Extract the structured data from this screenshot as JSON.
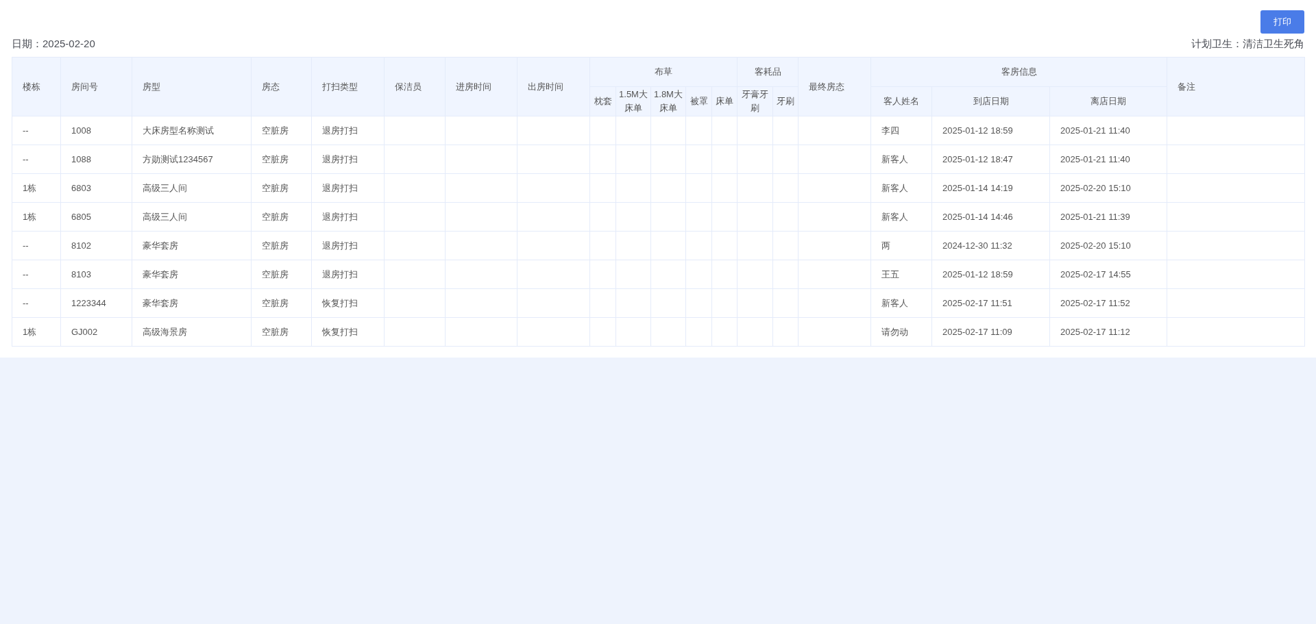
{
  "print_button": "打印",
  "date": "日期：2025-02-20",
  "plan": "计划卫生：清洁卫生死角",
  "table": {
    "columns": [
      {
        "label": "楼栋"
      },
      {
        "label": "房间号"
      },
      {
        "label": "房型"
      },
      {
        "label": "房态"
      },
      {
        "label": "打扫类型"
      },
      {
        "label": "保洁员"
      },
      {
        "label": "进房时间"
      },
      {
        "label": "出房时间"
      },
      {
        "label": "布草",
        "children": [
          {
            "label": "枕套"
          },
          {
            "label": "1.5M大床单"
          },
          {
            "label": "1.8M大床单"
          },
          {
            "label": "被罩"
          },
          {
            "label": "床单"
          }
        ]
      },
      {
        "label": "客耗品",
        "children": [
          {
            "label": "牙膏牙刷"
          },
          {
            "label": "牙刷"
          }
        ]
      },
      {
        "label": "最终房态"
      },
      {
        "label": "客房信息",
        "children": [
          {
            "label": "客人姓名"
          },
          {
            "label": "到店日期"
          },
          {
            "label": "离店日期"
          }
        ]
      },
      {
        "label": "备注"
      }
    ],
    "rows": [
      {
        "building": "--",
        "room_no": "1008",
        "room_type": "大床房型名称测试",
        "room_status": "空脏房",
        "clean_type": "退房打扫",
        "guest": "李四",
        "arrival": "2025-01-12 18:59",
        "departure": "2025-01-21 11:40"
      },
      {
        "building": "--",
        "room_no": "1088",
        "room_type": "方勋测试1234567",
        "room_status": "空脏房",
        "clean_type": "退房打扫",
        "guest": "新客人",
        "arrival": "2025-01-12 18:47",
        "departure": "2025-01-21 11:40"
      },
      {
        "building": "1栋",
        "room_no": "6803",
        "room_type": "高级三人间",
        "room_status": "空脏房",
        "clean_type": "退房打扫",
        "guest": "新客人",
        "arrival": "2025-01-14 14:19",
        "departure": "2025-02-20 15:10"
      },
      {
        "building": "1栋",
        "room_no": "6805",
        "room_type": "高级三人间",
        "room_status": "空脏房",
        "clean_type": "退房打扫",
        "guest": "新客人",
        "arrival": "2025-01-14 14:46",
        "departure": "2025-01-21 11:39"
      },
      {
        "building": "--",
        "room_no": "8102",
        "room_type": "豪华套房",
        "room_status": "空脏房",
        "clean_type": "退房打扫",
        "guest": "两",
        "arrival": "2024-12-30 11:32",
        "departure": "2025-02-20 15:10"
      },
      {
        "building": "--",
        "room_no": "8103",
        "room_type": "豪华套房",
        "room_status": "空脏房",
        "clean_type": "退房打扫",
        "guest": "王五",
        "arrival": "2025-01-12 18:59",
        "departure": "2025-02-17 14:55"
      },
      {
        "building": "--",
        "room_no": "1223344",
        "room_type": "豪华套房",
        "room_status": "空脏房",
        "clean_type": "恢复打扫",
        "guest": "新客人",
        "arrival": "2025-02-17 11:51",
        "departure": "2025-02-17 11:52"
      },
      {
        "building": "1栋",
        "room_no": "GJ002",
        "room_type": "高级海景房",
        "room_status": "空脏房",
        "clean_type": "恢复打扫",
        "guest": "请勿动",
        "arrival": "2025-02-17 11:09",
        "departure": "2025-02-17 11:12"
      }
    ]
  }
}
